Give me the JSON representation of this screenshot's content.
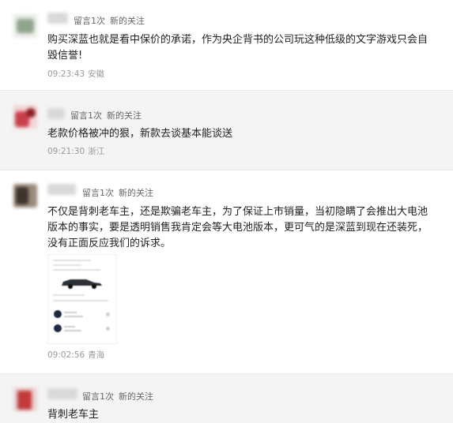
{
  "comments": [
    {
      "reply_count": "留言1次",
      "tag": "新的关注",
      "text": "购买深蓝也就是看中保价的承诺，作为央企背书的公司玩这种低级的文字游戏只会自毁信誉!",
      "time": "09:23:43",
      "location": "安徽",
      "avatar_color": "#8fa58d"
    },
    {
      "reply_count": "留言1次",
      "tag": "新的关注",
      "text": "老款价格被冲的狠，新款去谈基本能谈送",
      "time": "09:21:30",
      "location": "浙江",
      "avatar_color": "#c9404a"
    },
    {
      "reply_count": "留言1次",
      "tag": "新的关注",
      "text": "不仅是背刺老车主，还是欺骗老车主，为了保证上市销量，当初隐瞒了会推出大电池版本的事实，要是透明销售我肯定会等大电池版本，更可气的是深蓝到现在还装死，没有正面反应我们的诉求。",
      "time": "09:02:56",
      "location": "青海",
      "avatar_color": "#6c5a4e"
    },
    {
      "reply_count": "留言1次",
      "tag": "新的关注",
      "text": "背刺老车主",
      "avatar_color": "#c33a3a"
    }
  ]
}
